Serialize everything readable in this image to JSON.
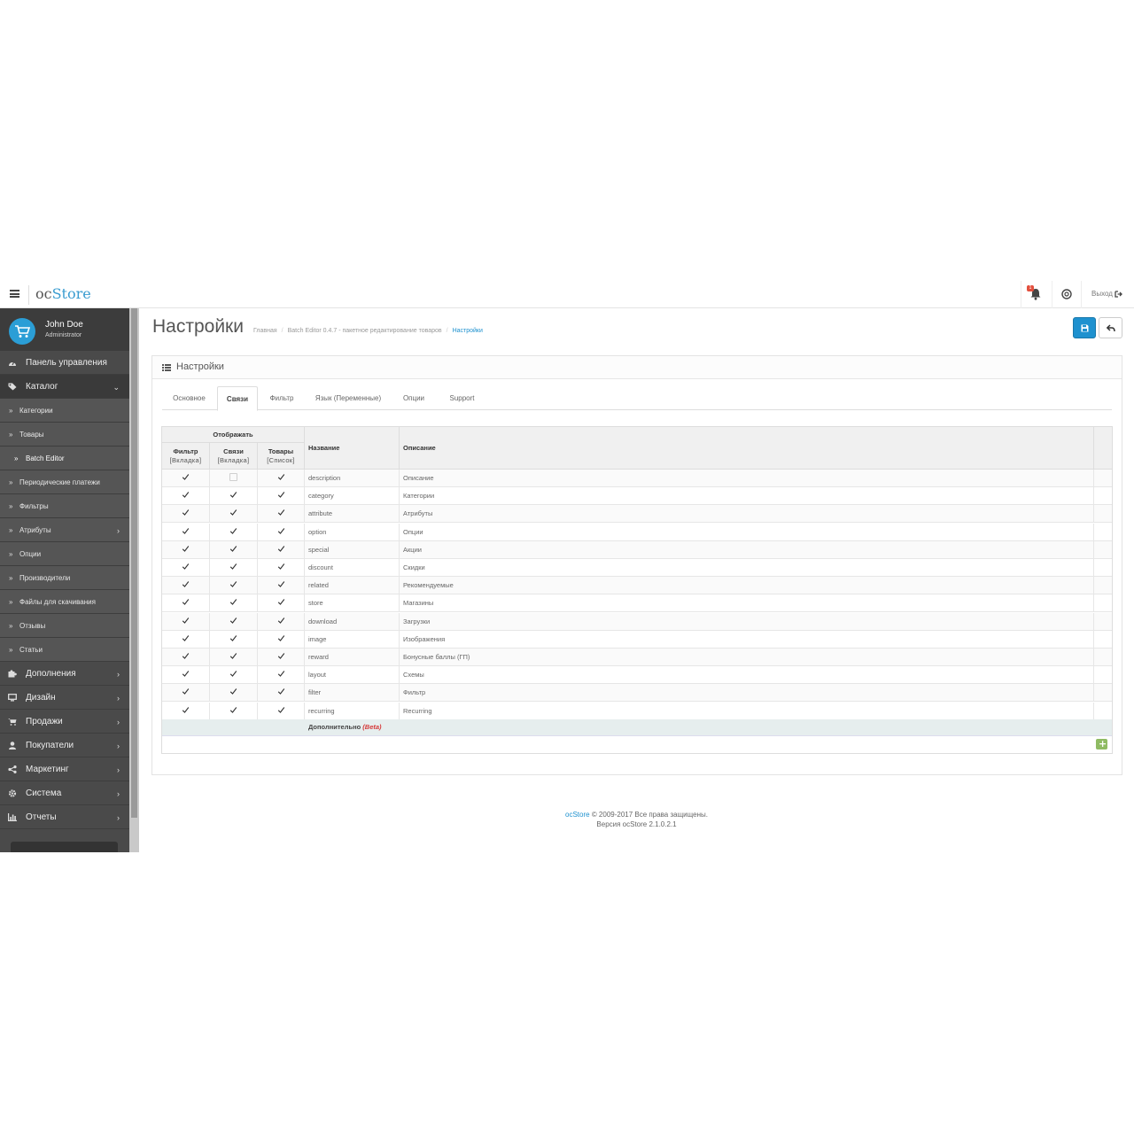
{
  "header": {
    "logo_part1": "oc",
    "logo_part2": "Store",
    "notification_count": "1",
    "logout_label": "Выход"
  },
  "profile": {
    "name": "John Doe",
    "role": "Administrator"
  },
  "sidebar": {
    "items": [
      {
        "label": "Панель управления",
        "level": "top",
        "icon": "dashboard-icon"
      },
      {
        "label": "Каталог",
        "level": "top",
        "icon": "tag-icon",
        "open": true
      },
      {
        "label": "Категории",
        "level": "sub"
      },
      {
        "label": "Товары",
        "level": "sub"
      },
      {
        "label": "Batch Editor",
        "level": "sub-active"
      },
      {
        "label": "Периодические платежи",
        "level": "sub"
      },
      {
        "label": "Фильтры",
        "level": "sub"
      },
      {
        "label": "Атрибуты",
        "level": "sub",
        "chevron": true
      },
      {
        "label": "Опции",
        "level": "sub"
      },
      {
        "label": "Производители",
        "level": "sub"
      },
      {
        "label": "Файлы для скачивания",
        "level": "sub"
      },
      {
        "label": "Отзывы",
        "level": "sub"
      },
      {
        "label": "Статьи",
        "level": "sub"
      },
      {
        "label": "Дополнения",
        "level": "top",
        "icon": "puzzle-icon",
        "chevron": true
      },
      {
        "label": "Дизайн",
        "level": "top",
        "icon": "monitor-icon",
        "chevron": true
      },
      {
        "label": "Продажи",
        "level": "top",
        "icon": "cart-icon",
        "chevron": true
      },
      {
        "label": "Покупатели",
        "level": "top",
        "icon": "user-icon",
        "chevron": true
      },
      {
        "label": "Маркетинг",
        "level": "top",
        "icon": "share-icon",
        "chevron": true
      },
      {
        "label": "Система",
        "level": "top",
        "icon": "gear-icon",
        "chevron": true
      },
      {
        "label": "Отчеты",
        "level": "top",
        "icon": "bar-chart-icon",
        "chevron": true
      }
    ]
  },
  "page": {
    "title": "Настройки",
    "breadcrumb": [
      "Главная",
      "Batch Editor 0.4.7 - пакетное редактирование товаров",
      "Настройки"
    ]
  },
  "panel": {
    "title": "Настройки"
  },
  "tabs": [
    {
      "label": "Основное",
      "active": false
    },
    {
      "label": "Связи",
      "active": true
    },
    {
      "label": "Фильтр",
      "active": false
    },
    {
      "label": "Язык (Переменные)",
      "active": false
    },
    {
      "label": "Опции",
      "active": false
    },
    {
      "label": "Support",
      "active": false
    }
  ],
  "table": {
    "group_header": "Отображать",
    "headers": {
      "filter": "Фильтр",
      "filter_sub": "[Вкладка]",
      "links": "Связи",
      "links_sub": "[Вкладка]",
      "products": "Товары",
      "products_sub": "[Список]",
      "name": "Название",
      "description": "Описание"
    },
    "rows": [
      {
        "name": "description",
        "desc": "Описание",
        "filter": true,
        "links": false,
        "products": true
      },
      {
        "name": "category",
        "desc": "Категории",
        "filter": true,
        "links": true,
        "products": true
      },
      {
        "name": "attribute",
        "desc": "Атрибуты",
        "filter": true,
        "links": true,
        "products": true
      },
      {
        "name": "option",
        "desc": "Опции",
        "filter": true,
        "links": true,
        "products": true
      },
      {
        "name": "special",
        "desc": "Акции",
        "filter": true,
        "links": true,
        "products": true
      },
      {
        "name": "discount",
        "desc": "Скидки",
        "filter": true,
        "links": true,
        "products": true
      },
      {
        "name": "related",
        "desc": "Рекомендуемые",
        "filter": true,
        "links": true,
        "products": true
      },
      {
        "name": "store",
        "desc": "Магазины",
        "filter": true,
        "links": true,
        "products": true
      },
      {
        "name": "download",
        "desc": "Загрузки",
        "filter": true,
        "links": true,
        "products": true
      },
      {
        "name": "image",
        "desc": "Изображения",
        "filter": true,
        "links": true,
        "products": true
      },
      {
        "name": "reward",
        "desc": "Бонусные баллы (ГП)",
        "filter": true,
        "links": true,
        "products": true
      },
      {
        "name": "layout",
        "desc": "Схемы",
        "filter": true,
        "links": true,
        "products": true
      },
      {
        "name": "filter",
        "desc": "Фильтр",
        "filter": true,
        "links": true,
        "products": true
      },
      {
        "name": "recurring",
        "desc": "Recurring",
        "filter": true,
        "links": true,
        "products": true
      }
    ],
    "extra_label": "Дополнительно",
    "extra_beta": "(Beta)"
  },
  "footer": {
    "brand": "ocStore",
    "copyright": "© 2009-2017 Все права защищены.",
    "version": "Версия ocStore 2.1.0.2.1"
  },
  "colors": {
    "accent": "#1e91cf",
    "sidebar": "#4a4a4a",
    "add_button": "#8fbb63",
    "beta": "#d63a3a"
  }
}
